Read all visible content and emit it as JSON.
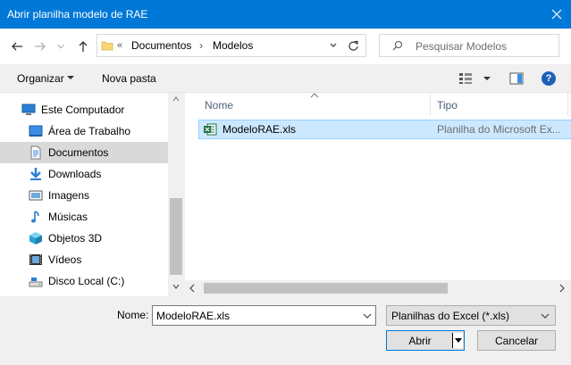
{
  "window": {
    "title": "Abrir planilha modelo de RAE"
  },
  "address": {
    "overflow": "«",
    "crumbs": [
      "Documentos",
      "Modelos"
    ]
  },
  "search": {
    "placeholder": "Pesquisar Modelos"
  },
  "toolbar": {
    "organize_label": "Organizar",
    "new_folder_label": "Nova pasta",
    "help_label": "?"
  },
  "sidebar": {
    "items": [
      {
        "label": "Este Computador",
        "icon": "computer-icon"
      },
      {
        "label": "Área de Trabalho",
        "icon": "desktop-icon"
      },
      {
        "label": "Documentos",
        "icon": "documents-icon",
        "selected": true
      },
      {
        "label": "Downloads",
        "icon": "downloads-icon"
      },
      {
        "label": "Imagens",
        "icon": "pictures-icon"
      },
      {
        "label": "Músicas",
        "icon": "music-icon"
      },
      {
        "label": "Objetos 3D",
        "icon": "objects-3d-icon"
      },
      {
        "label": "Vídeos",
        "icon": "videos-icon"
      },
      {
        "label": "Disco Local (C:)",
        "icon": "local-disk-icon"
      }
    ]
  },
  "file_list": {
    "columns": [
      "Nome",
      "Tipo"
    ],
    "rows": [
      {
        "name": "ModeloRAE.xls",
        "type": "Planilha do Microsoft Ex...",
        "icon": "excel-file-icon",
        "selected": true
      }
    ]
  },
  "footer": {
    "name_label": "Nome:",
    "name_value": "ModeloRAE.xls",
    "filter_value": "Planilhas do Excel  (*.xls)",
    "open_label": "Abrir",
    "cancel_label": "Cancelar"
  },
  "colors": {
    "titlebar": "#0078d7",
    "selection": "#cce8ff",
    "accent": "#0078d7"
  }
}
